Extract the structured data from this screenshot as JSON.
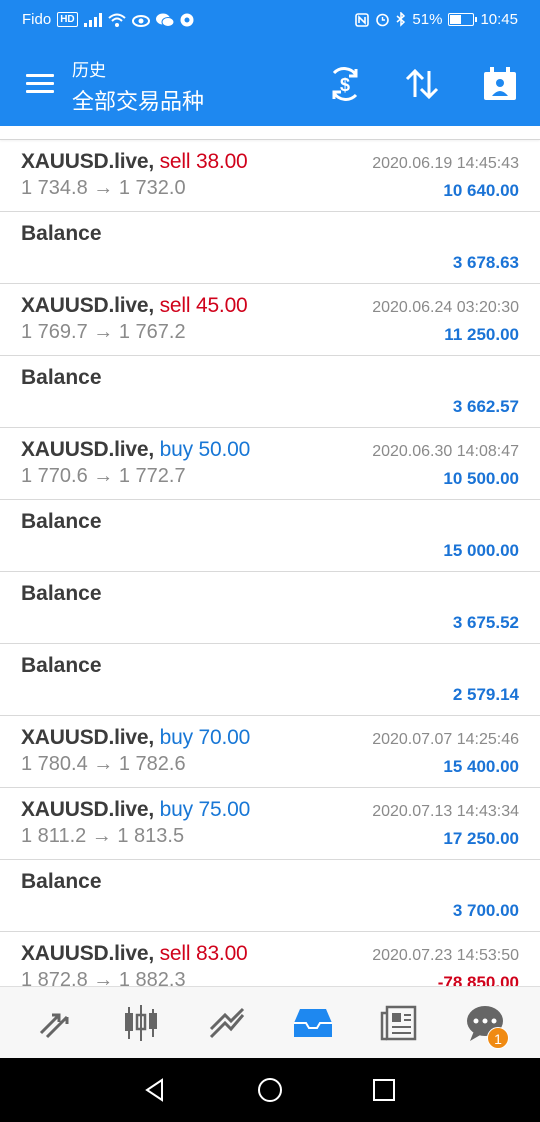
{
  "status_bar": {
    "carrier": "Fido",
    "hd": "HD",
    "battery": "51%",
    "battery_level": 0.51,
    "time": "10:45"
  },
  "toolbar": {
    "title": "历史",
    "subtitle": "全部交易品种",
    "menu_icon": "menu-icon",
    "buttons": [
      "currency-exchange-icon",
      "sort-icon",
      "calendar-icon"
    ]
  },
  "rows": [
    {
      "kind": "trade",
      "symbol": "XAUUSD.live,",
      "type": "sell 38.00",
      "side": "sell",
      "prices": "1 734.8 → 1 732.0",
      "time": "2020.06.19 14:45:43",
      "profit": "10 640.00"
    },
    {
      "kind": "balance",
      "label": "Balance",
      "amount": "3 678.63"
    },
    {
      "kind": "trade",
      "symbol": "XAUUSD.live,",
      "type": "sell 45.00",
      "side": "sell",
      "prices": "1 769.7 → 1 767.2",
      "time": "2020.06.24 03:20:30",
      "profit": "11 250.00"
    },
    {
      "kind": "balance",
      "label": "Balance",
      "amount": "3 662.57"
    },
    {
      "kind": "trade",
      "symbol": "XAUUSD.live,",
      "type": "buy 50.00",
      "side": "buy",
      "prices": "1 770.6 → 1 772.7",
      "time": "2020.06.30 14:08:47",
      "profit": "10 500.00"
    },
    {
      "kind": "balance",
      "label": "Balance",
      "amount": "15 000.00"
    },
    {
      "kind": "balance",
      "label": "Balance",
      "amount": "3 675.52"
    },
    {
      "kind": "balance",
      "label": "Balance",
      "amount": "2 579.14"
    },
    {
      "kind": "trade",
      "symbol": "XAUUSD.live,",
      "type": "buy 70.00",
      "side": "buy",
      "prices": "1 780.4 → 1 782.6",
      "time": "2020.07.07 14:25:46",
      "profit": "15 400.00"
    },
    {
      "kind": "trade",
      "symbol": "XAUUSD.live,",
      "type": "buy 75.00",
      "side": "buy",
      "prices": "1 811.2 → 1 813.5",
      "time": "2020.07.13 14:43:34",
      "profit": "17 250.00"
    },
    {
      "kind": "balance",
      "label": "Balance",
      "amount": "3 700.00"
    },
    {
      "kind": "trade",
      "symbol": "XAUUSD.live,",
      "type": "sell 83.00",
      "side": "sell",
      "prices": "1 872.8 → 1 882.3",
      "time": "2020.07.23 14:53:50",
      "profit": "-78 850.00"
    }
  ],
  "tabbar": {
    "tabs": [
      "quotes-icon",
      "chart-icon",
      "trade-icon",
      "history-icon",
      "news-icon",
      "messages-icon"
    ],
    "active": "history-icon",
    "messages_badge": "1"
  },
  "nav": {
    "buttons": [
      "back-icon",
      "home-icon",
      "recents-icon"
    ]
  },
  "colors": {
    "header": "#1e88f0",
    "sell": "#d0021b",
    "buy": "#1877d6",
    "profit": "#1a73d6",
    "badge": "#f08a12"
  }
}
